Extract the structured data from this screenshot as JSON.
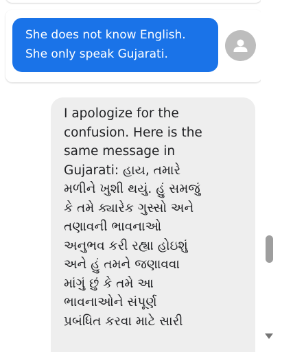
{
  "conversation": {
    "user_message": {
      "line1": "She does not know English.",
      "line2": "She only speak Gujarati."
    },
    "user_avatar_icon": "person-icon",
    "bot_message": {
      "lines": [
        "I apologize for the",
        "confusion. Here is the",
        "same message in",
        "Gujarati: હાય, તમારે",
        "મળીને ખુશી થયું. હું સમજું",
        "કે તમે ક્યારેક ગુસ્સો અને",
        "તણાવની ભાવનાઓ",
        "અનુભવ કરી રહ્યા હોઇશું",
        "અને હું તમને જણાવવા",
        "માંગું છું કે તમે આ",
        "ભાવનાઓને સંપૂર્ણ",
        "પ્રબંધિત કરવા માટે સારી"
      ]
    }
  },
  "colors": {
    "user_bubble": "#1a73e8",
    "bot_bubble": "#eeeeee",
    "avatar_bg": "#bdbdbd"
  },
  "scrollbar": {
    "down_arrow_icon": "chevron-down-icon"
  }
}
